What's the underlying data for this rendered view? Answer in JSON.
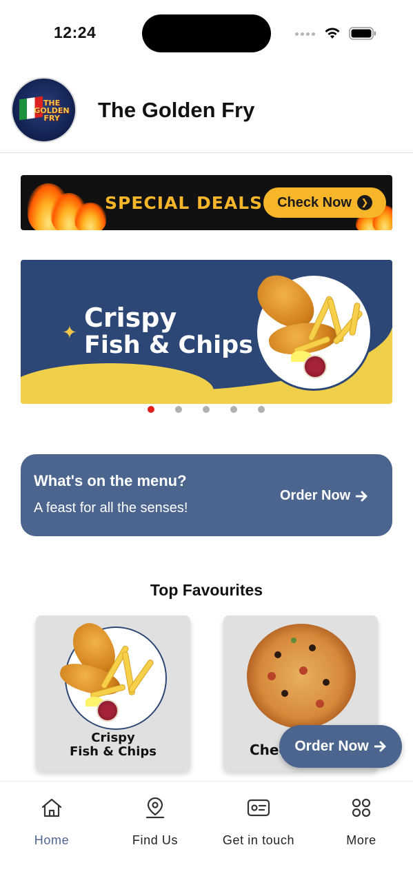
{
  "status_bar": {
    "time": "12:24"
  },
  "header": {
    "title": "The Golden Fry",
    "logo_text": "THE GOLDEN FRY"
  },
  "deals_banner": {
    "text": "SPECIAL DEALS",
    "button_label": "Check Now"
  },
  "hero": {
    "line1": "Crispy",
    "line2": "Fish & Chips",
    "slide_count": 5,
    "active_slide": 1,
    "colors": {
      "blue": "#2c4776",
      "yellow": "#f0d04a",
      "active_dot": "#e0201c"
    }
  },
  "menu_card": {
    "title": "What's on the menu?",
    "subtitle": "A feast for all the senses!",
    "action_label": "Order Now",
    "action_icon": "arrow-right-icon",
    "color": "#4c658f"
  },
  "favourites": {
    "heading": "Top Favourites",
    "items": [
      {
        "name_line1": "Crispy",
        "name_line2": "Fish & Chips"
      },
      {
        "name_visible": "Chee"
      }
    ]
  },
  "floating_button": {
    "label": "Order Now",
    "icon": "arrow-right-icon"
  },
  "bottom_nav": {
    "items": [
      {
        "label": "Home",
        "icon": "home-icon",
        "active": true
      },
      {
        "label": "Find Us",
        "icon": "location-pin-icon",
        "active": false
      },
      {
        "label": "Get in touch",
        "icon": "contact-card-icon",
        "active": false
      },
      {
        "label": "More",
        "icon": "grid-icon",
        "active": false
      }
    ],
    "active_color": "#4c658f"
  }
}
